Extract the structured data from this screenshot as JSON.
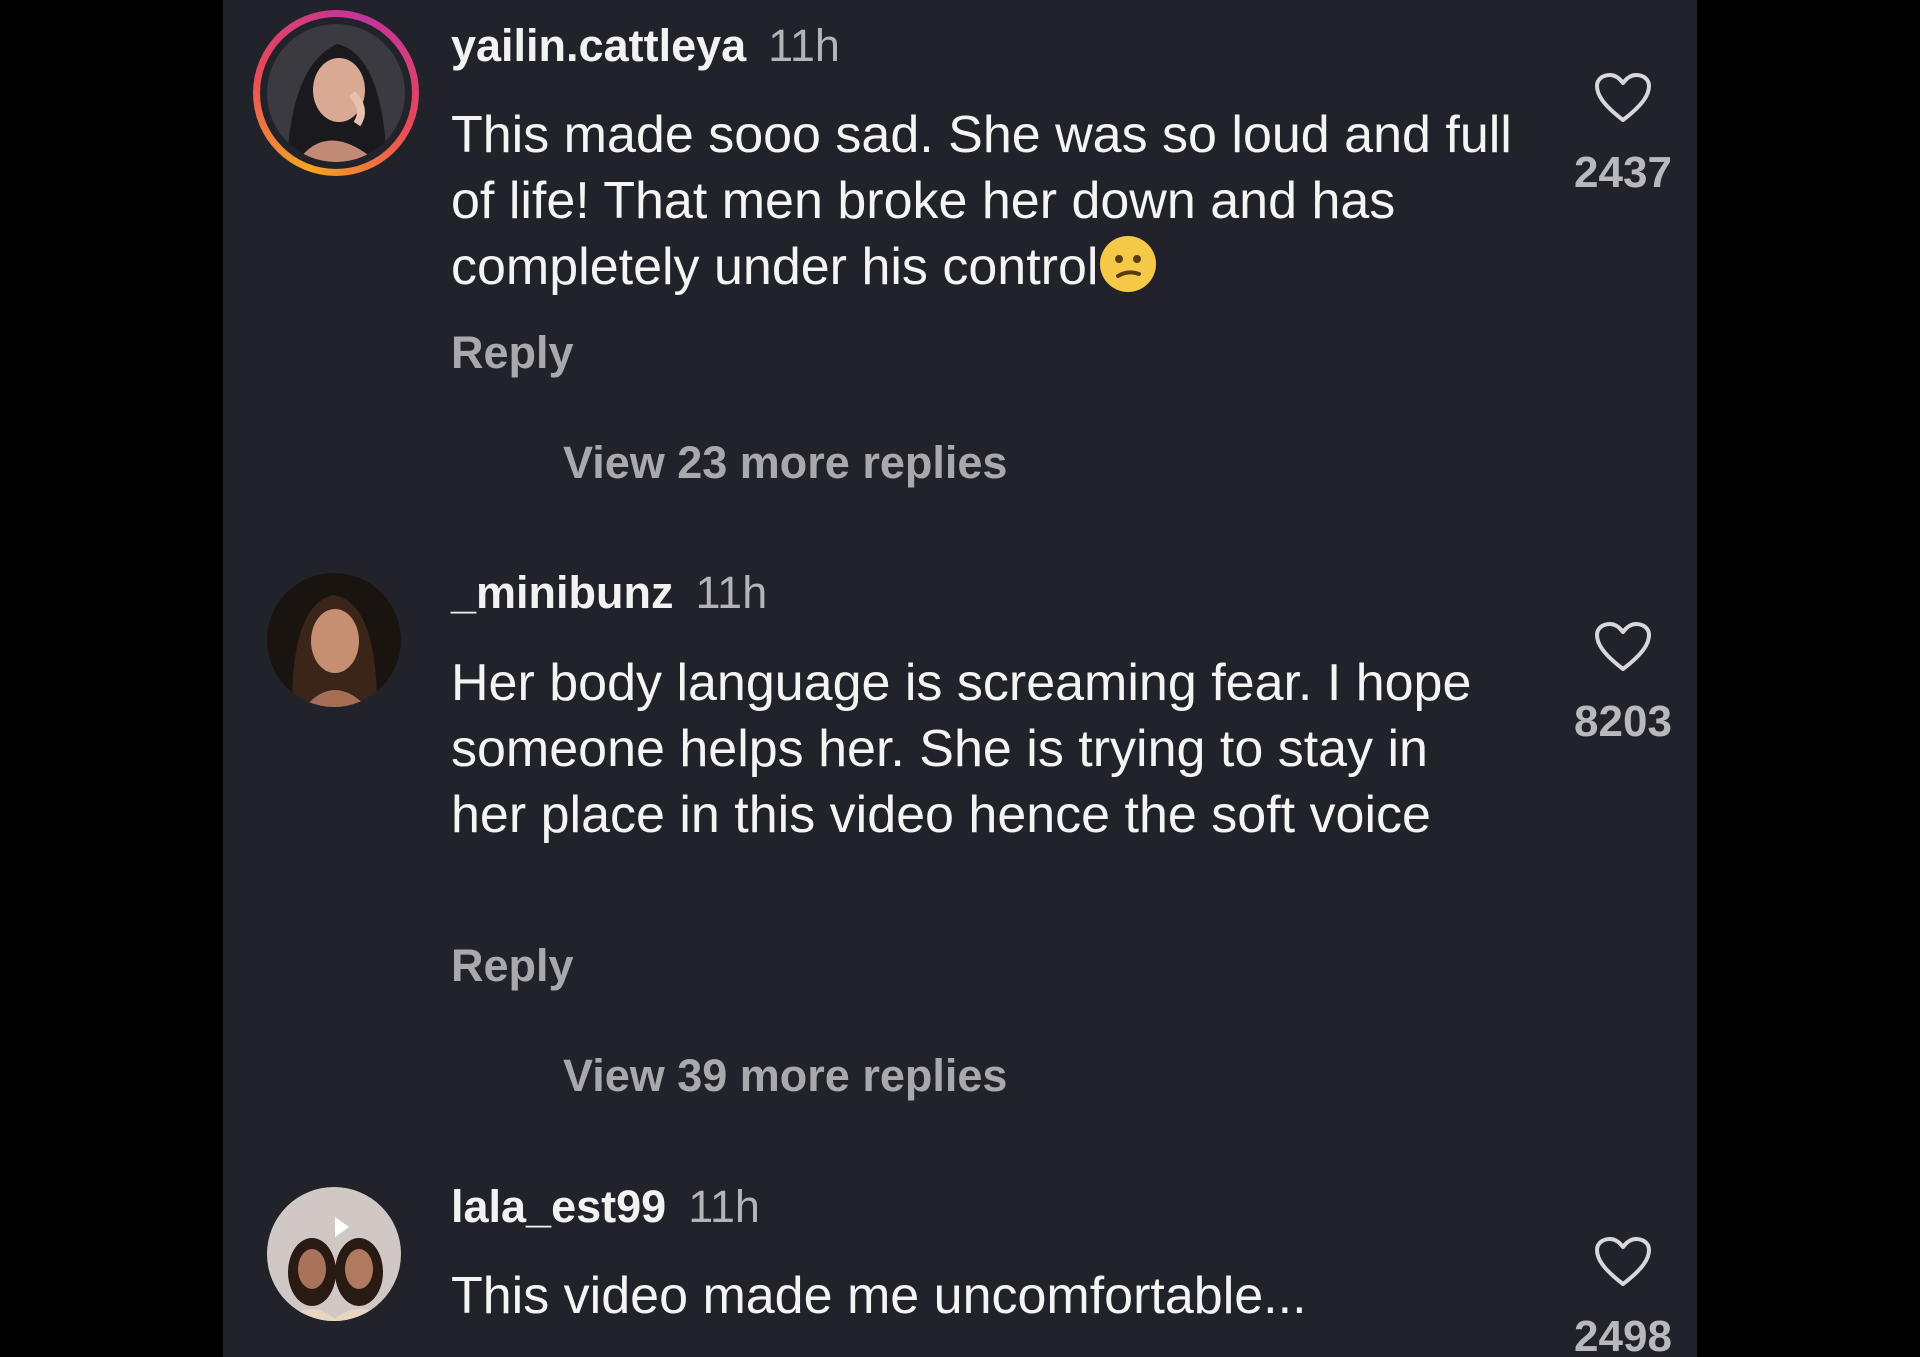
{
  "comments": [
    {
      "username": "yailin.cattleya",
      "time": "11h",
      "text": "This made sooo sad. She was so loud and full of life! That men broke her down and has completely under his control",
      "emoji": "confused-face",
      "reply_label": "Reply",
      "view_more": "View 23 more replies",
      "likes": "2437",
      "has_story_ring": true
    },
    {
      "username": "_minibunz",
      "time": "11h",
      "text": "Her body language is screaming fear. I hope someone helps her. She is trying to stay in her place in this video hence the soft voice",
      "reply_label": "Reply",
      "view_more": "View 39 more replies",
      "likes": "8203",
      "has_story_ring": false
    },
    {
      "username": "lala_est99",
      "time": "11h",
      "text": "This video made me uncomfortable...",
      "likes": "2498",
      "has_story_ring": false
    }
  ],
  "colors": {
    "background": "#22232a",
    "outer": "#000000",
    "primary_text": "#f4f4f4",
    "secondary_text": "#a8a8ad",
    "story_ring": "#e8455c"
  }
}
